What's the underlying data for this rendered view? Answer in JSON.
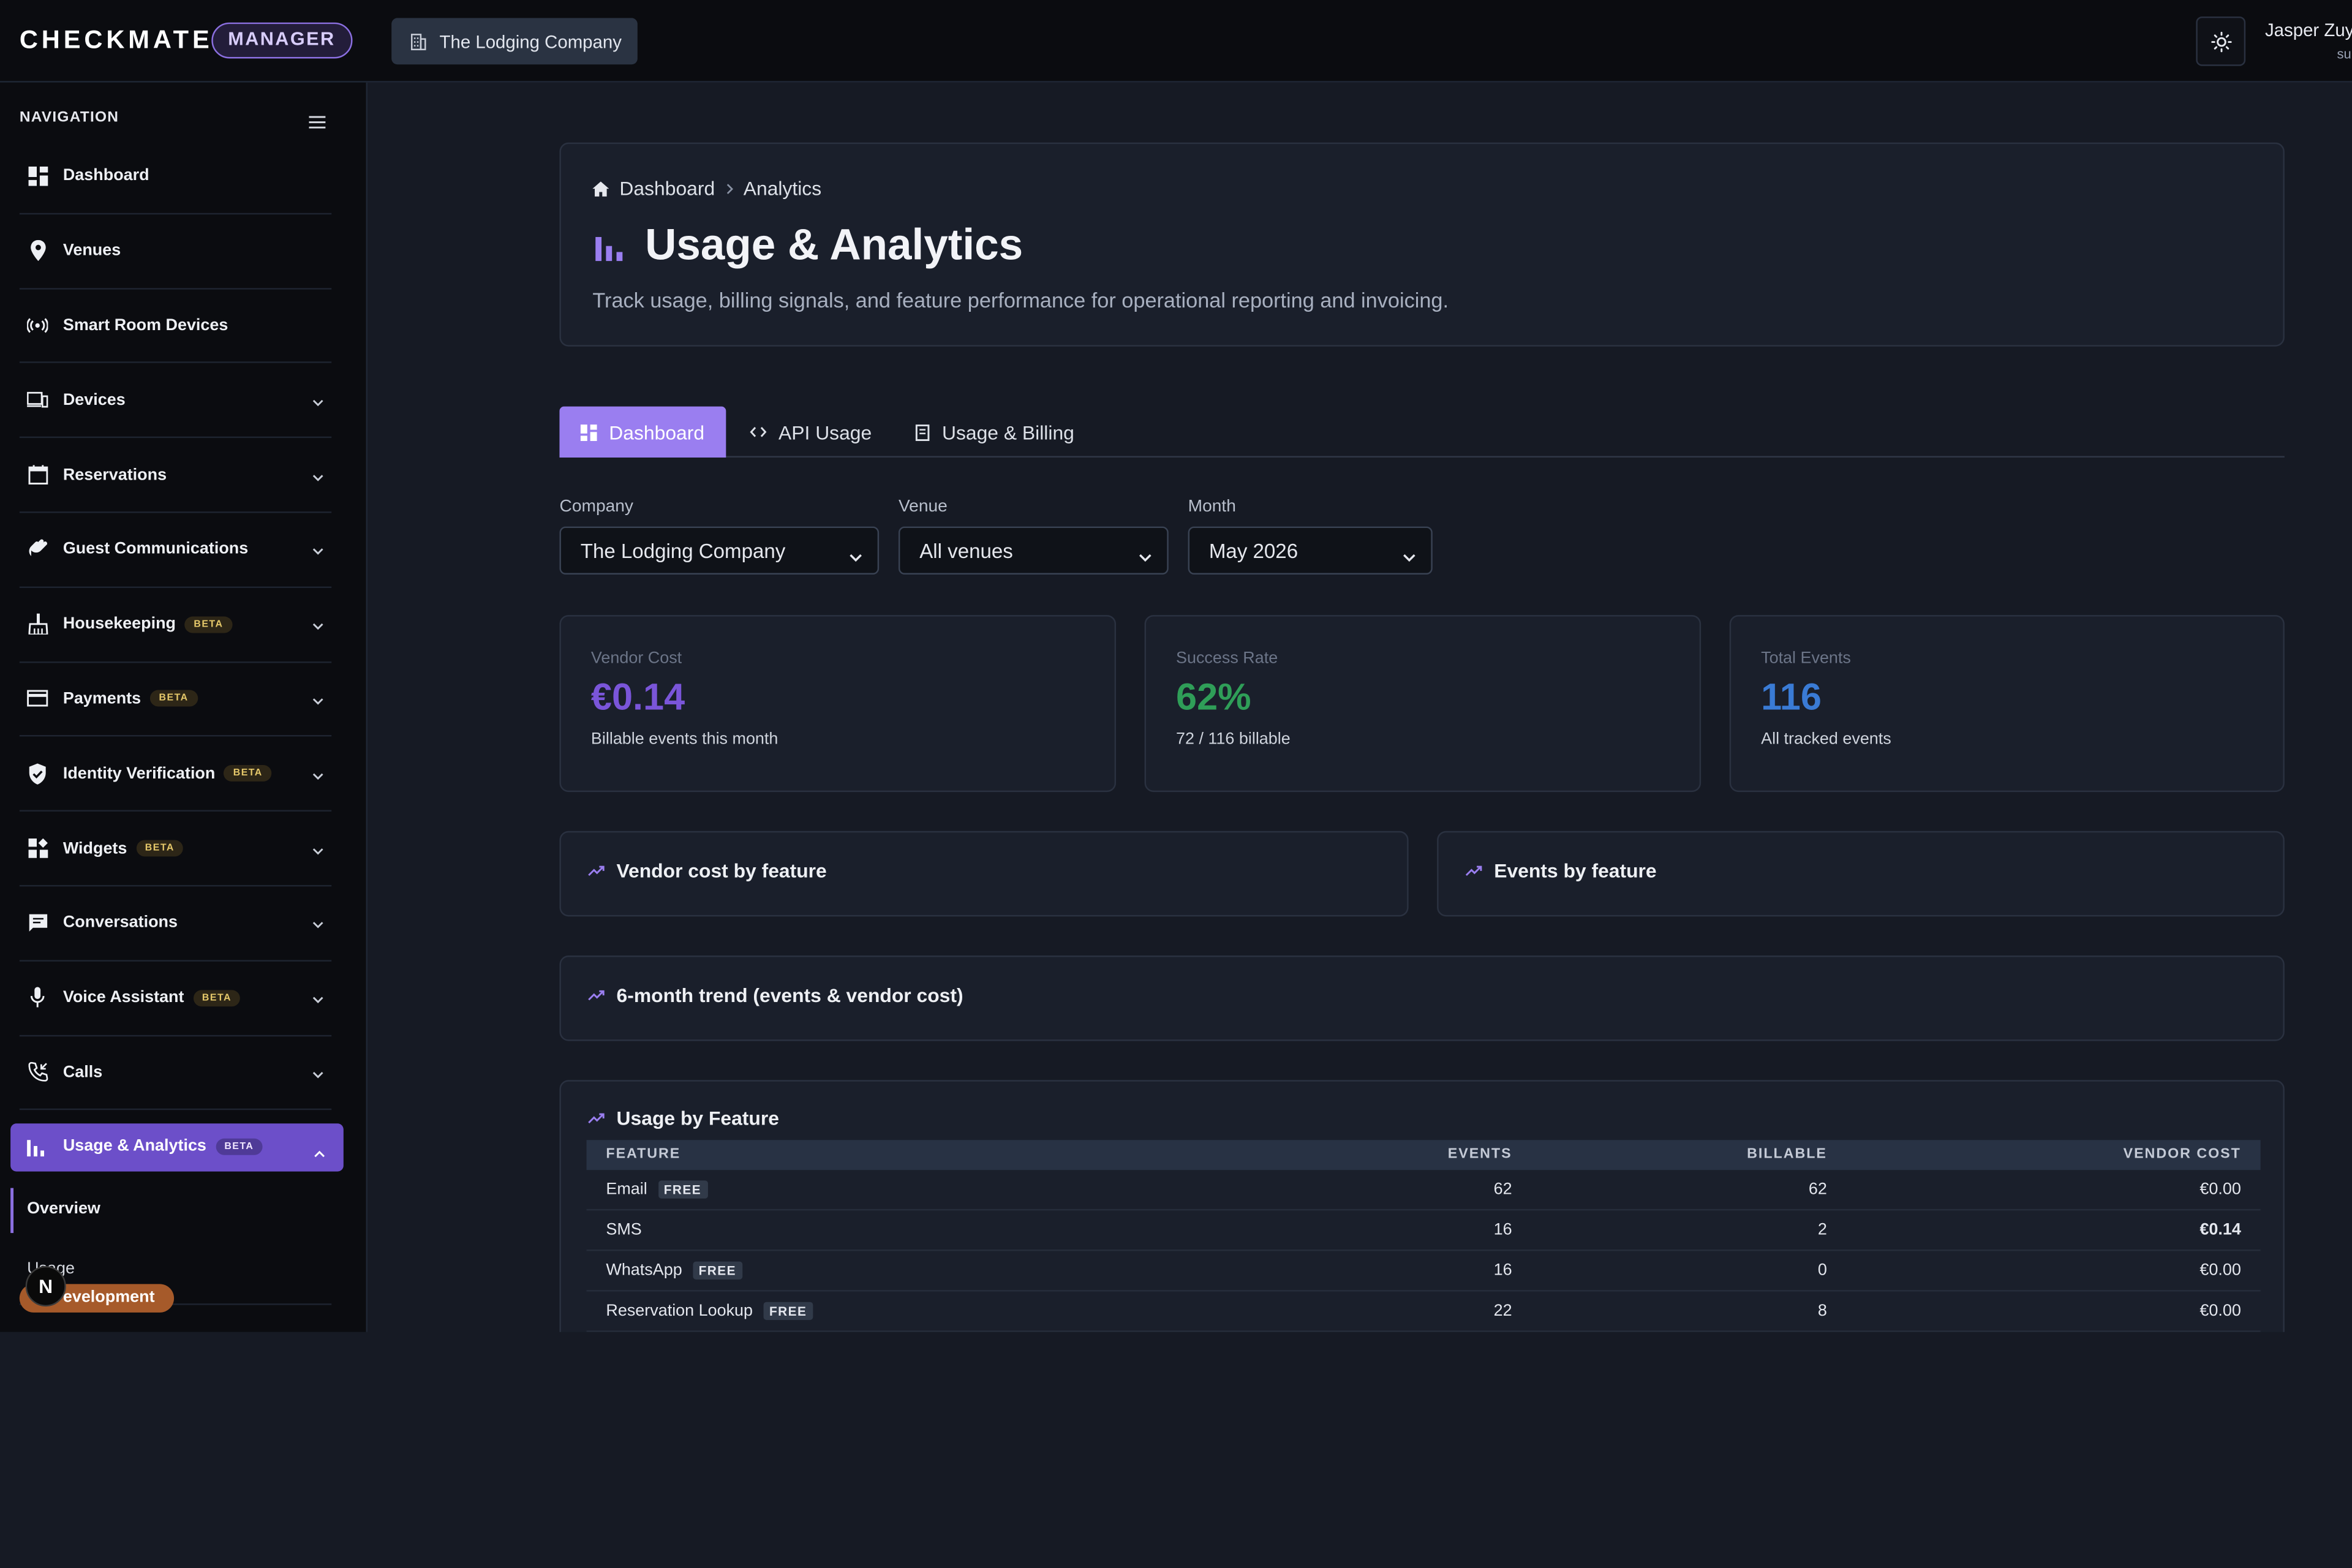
{
  "app": {
    "logo": "CHECKMATE",
    "role_badge": "MANAGER",
    "company_chip": "The Lodging Company",
    "user_name": "Jasper Zuy",
    "user_role": "su"
  },
  "sidebar": {
    "title": "NAVIGATION",
    "items": [
      {
        "label": "Dashboard",
        "icon": "dashboard-icon",
        "chevron": false,
        "beta": ""
      },
      {
        "label": "Venues",
        "icon": "location-pin-icon",
        "chevron": false,
        "beta": ""
      },
      {
        "label": "Smart Room Devices",
        "icon": "broadcast-icon",
        "chevron": false,
        "beta": ""
      },
      {
        "label": "Devices",
        "icon": "devices-icon",
        "chevron": true,
        "beta": ""
      },
      {
        "label": "Reservations",
        "icon": "calendar-icon",
        "chevron": true,
        "beta": ""
      },
      {
        "label": "Guest Communications",
        "icon": "waving-hand-icon",
        "chevron": true,
        "beta": ""
      },
      {
        "label": "Housekeeping",
        "icon": "broom-icon",
        "chevron": true,
        "beta": "BETA"
      },
      {
        "label": "Payments",
        "icon": "credit-card-icon",
        "chevron": true,
        "beta": "BETA"
      },
      {
        "label": "Identity Verification",
        "icon": "shield-check-icon",
        "chevron": true,
        "beta": "BETA"
      },
      {
        "label": "Widgets",
        "icon": "widgets-icon",
        "chevron": true,
        "beta": "BETA"
      },
      {
        "label": "Conversations",
        "icon": "chat-icon",
        "chevron": true,
        "beta": ""
      },
      {
        "label": "Voice Assistant",
        "icon": "microphone-icon",
        "chevron": true,
        "beta": "BETA"
      },
      {
        "label": "Calls",
        "icon": "phone-call-icon",
        "chevron": true,
        "beta": ""
      }
    ],
    "active_item": {
      "label": "Usage & Analytics",
      "beta": "BETA"
    },
    "sub_items": [
      "Overview",
      "Usage"
    ],
    "dev_pill": "evelopment",
    "dev_logo": "N"
  },
  "header": {
    "breadcrumb": [
      "Dashboard",
      "Analytics"
    ],
    "title": "Usage & Analytics",
    "description": "Track usage, billing signals, and feature performance for operational reporting and invoicing."
  },
  "tabs": [
    {
      "label": "Dashboard",
      "active": true
    },
    {
      "label": "API Usage",
      "active": false
    },
    {
      "label": "Usage & Billing",
      "active": false
    }
  ],
  "filters": {
    "company": {
      "label": "Company",
      "value": "The Lodging Company"
    },
    "venue": {
      "label": "Venue",
      "value": "All venues"
    },
    "month": {
      "label": "Month",
      "value": "May 2026"
    }
  },
  "stats": [
    {
      "label": "Vendor Cost",
      "value": "€0.14",
      "sub": "Billable events this month",
      "color": "#7a55d9"
    },
    {
      "label": "Success Rate",
      "value": "62%",
      "sub": "72 / 116 billable",
      "color": "#2f9e58"
    },
    {
      "label": "Total Events",
      "value": "116",
      "sub": "All tracked events",
      "color": "#3a7bd5"
    }
  ],
  "panels": {
    "vendor_cost": "Vendor cost by feature",
    "events": "Events by feature",
    "trend": "6-month trend (events & vendor cost)"
  },
  "usage_table": {
    "title": "Usage by Feature",
    "columns": [
      "FEATURE",
      "EVENTS",
      "BILLABLE",
      "VENDOR COST"
    ],
    "rows": [
      {
        "feature": "Email",
        "free": "FREE",
        "events": "62",
        "billable": "62",
        "cost": "€0.00",
        "bold": false
      },
      {
        "feature": "SMS",
        "free": "",
        "events": "16",
        "billable": "2",
        "cost": "€0.14",
        "bold": true
      },
      {
        "feature": "WhatsApp",
        "free": "FREE",
        "events": "16",
        "billable": "0",
        "cost": "€0.00",
        "bold": false
      },
      {
        "feature": "Reservation Lookup",
        "free": "FREE",
        "events": "22",
        "billable": "8",
        "cost": "€0.00",
        "bold": false
      }
    ]
  },
  "colors": {
    "accent": "#9a7ef0",
    "active_nav": "#6c4fc9"
  }
}
